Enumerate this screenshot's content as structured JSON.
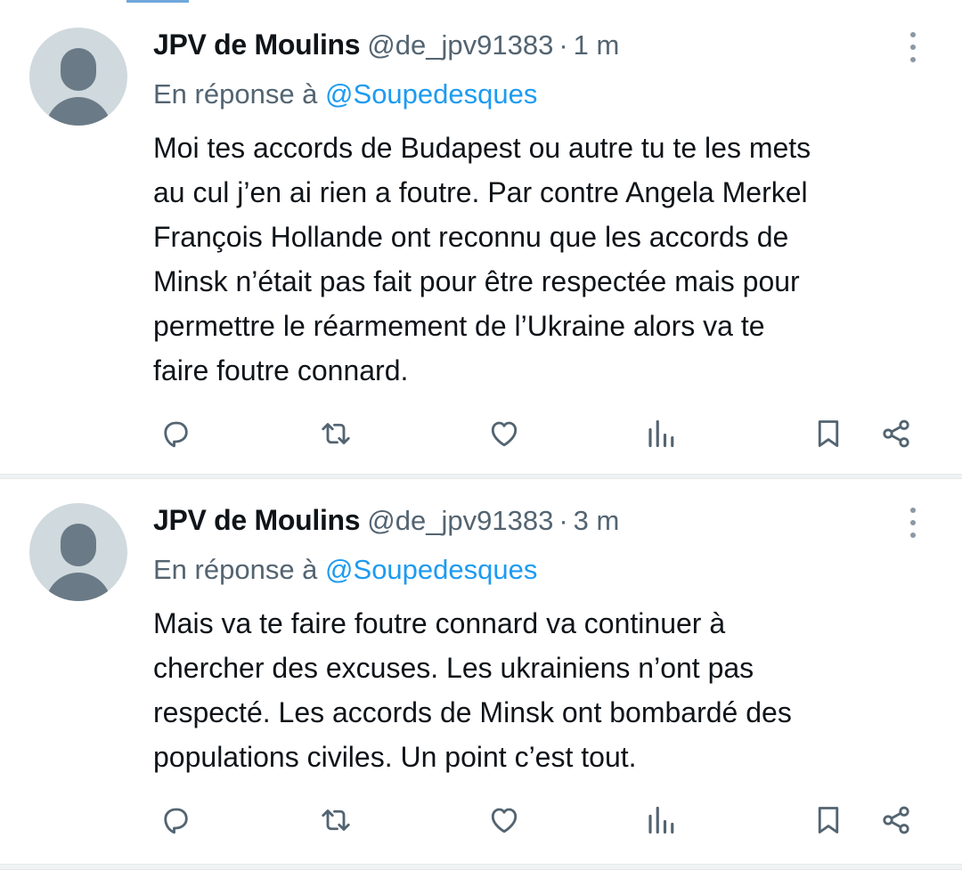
{
  "tweets": [
    {
      "display_name": "JPV de Moulins",
      "handle": "@de_jpv91383",
      "separator": "·",
      "time": "1 m",
      "reply_prefix": "En réponse à",
      "reply_to": "@Soupedesques",
      "text": "Moi tes accords de Budapest ou autre tu te les mets\nau cul j’en ai rien a foutre. Par contre Angela Merkel\nFrançois Hollande ont reconnu que les accords de\nMinsk n’était pas fait pour être respectée mais pour\npermettre le réarmement de l’Ukraine alors va te\nfaire foutre connard."
    },
    {
      "display_name": "JPV de Moulins",
      "handle": "@de_jpv91383",
      "separator": "·",
      "time": "3 m",
      "reply_prefix": "En réponse à",
      "reply_to": "@Soupedesques",
      "text": "Mais va te faire foutre connard va continuer à\nchercher des excuses. Les ukrainiens n’ont pas\nrespecté. Les accords de Minsk ont bombardé des\npopulations civiles. Un point c’est tout."
    }
  ],
  "icons": {
    "more": "more-vertical-icon",
    "reply": "reply-icon",
    "retweet": "retweet-icon",
    "like": "heart-icon",
    "views": "views-icon",
    "bookmark": "bookmark-icon",
    "share": "share-icon"
  },
  "colors": {
    "text": "#0f1419",
    "secondary": "#536471",
    "link": "#1d9bf0",
    "avatar_bg": "#cfd9de",
    "avatar_fg": "#6a7a86",
    "divider": "#eff3f4"
  }
}
